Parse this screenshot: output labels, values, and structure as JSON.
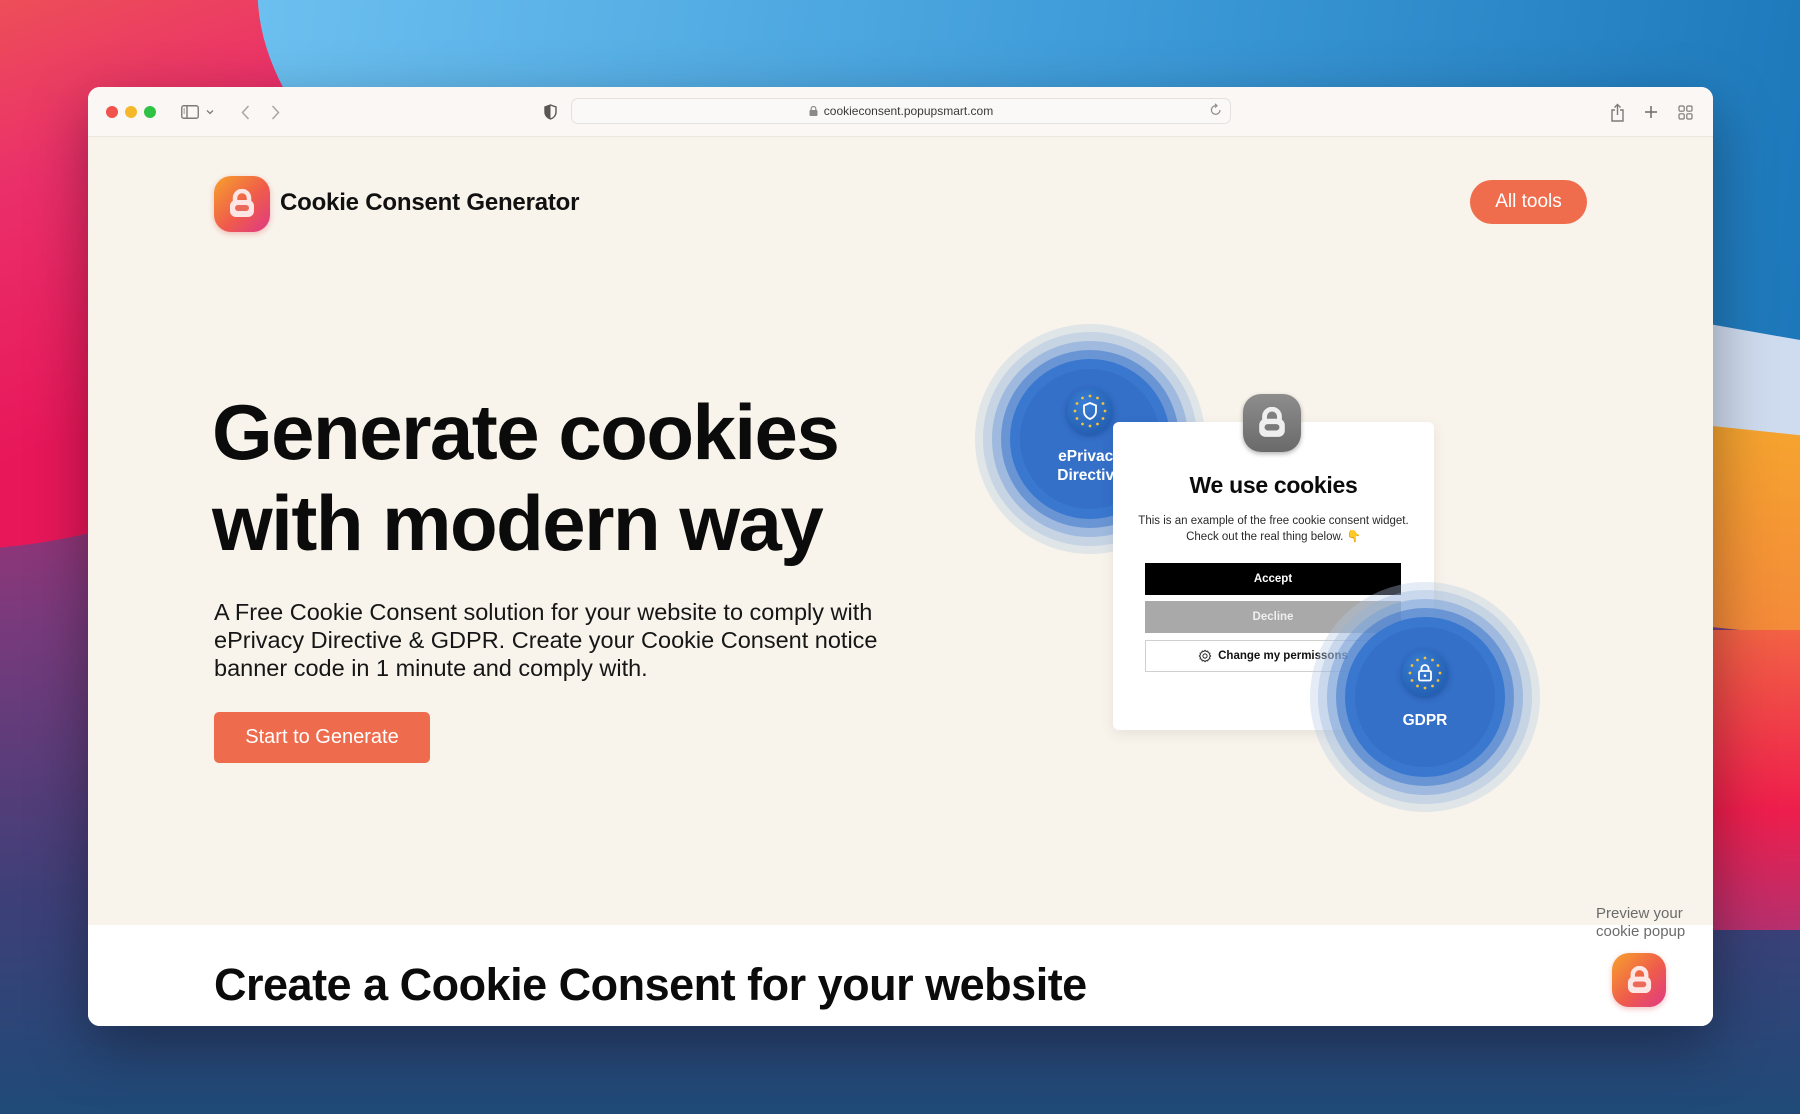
{
  "browser": {
    "url": "cookieconsent.popupsmart.com",
    "icons": {
      "close": "traffic-light-red",
      "minimize": "traffic-light-yellow",
      "maximize": "traffic-light-green",
      "sidebar": "sidebar-icon",
      "sidebar_menu": "chevron-down-icon",
      "back": "chevron-left-icon",
      "forward": "chevron-right-icon",
      "privacy": "shield-half-icon",
      "reload": "reload-icon",
      "share": "share-icon",
      "new_tab": "plus-icon",
      "tab_overview": "grid-icon"
    }
  },
  "header": {
    "brand_title": "Cookie Consent Generator",
    "all_tools_label": "All tools"
  },
  "hero": {
    "title_line1": "Generate cookies",
    "title_line2": "with modern way",
    "description": "A Free Cookie Consent solution for your website to comply with ePrivacy Directive & GDPR. Create your Cookie Consent notice banner code in 1 minute and comply with.",
    "cta_label": "Start to Generate"
  },
  "illustration": {
    "eprivacy_badge": {
      "label_line1": "ePrivacy",
      "label_line2": "Directive",
      "icon": "shield-icon"
    },
    "gdpr_badge": {
      "label": "GDPR",
      "icon": "lock-icon"
    },
    "popup": {
      "title": "We use cookies",
      "text": "This is an example of the free cookie consent widget. Check out the real thing below. 👇",
      "accept_label": "Accept",
      "decline_label": "Decline",
      "change_label": "Change my permissons"
    }
  },
  "section2": {
    "title": "Create a Cookie Consent for your website"
  },
  "preview_widget": {
    "text_line1": "Preview your",
    "text_line2": "cookie popup"
  },
  "colors": {
    "accent": "#ee6c4d",
    "page_background": "#f8f4ec",
    "badge_blue": "#2f6fce",
    "accept_button": "#000000",
    "decline_button": "#a9a9a9"
  }
}
